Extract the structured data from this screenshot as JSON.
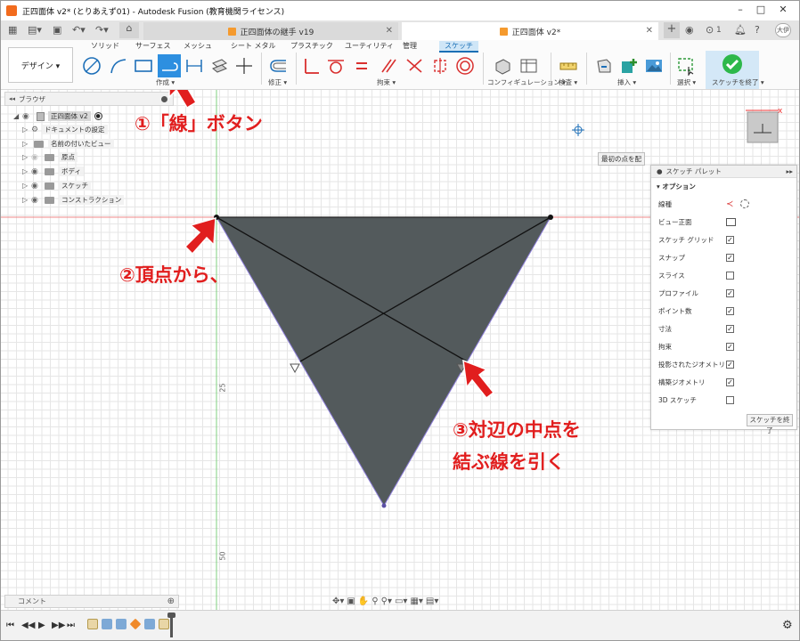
{
  "window": {
    "title": "正四面体 v2* (とりあえず01) - Autodesk Fusion (教育機関ライセンス)",
    "controls": [
      "–",
      "□",
      "✕"
    ]
  },
  "doc_tabs": [
    {
      "label": "正四面体の継手 v19",
      "active": false
    },
    {
      "label": "正四面体 v2*",
      "active": true
    }
  ],
  "tabbar_right": {
    "notifications": "1",
    "user_initial": "大伊"
  },
  "toolbar": {
    "design_label": "デザイン ▾",
    "tabs": [
      "ソリッド",
      "サーフェス",
      "メッシュ",
      "シート メタル",
      "プラスチック",
      "ユーティリティ",
      "管理",
      "スケッチ"
    ],
    "groups": [
      "作成 ▾",
      "修正 ▾",
      "拘束 ▾",
      "コンフィギュレーション ▾",
      "検査 ▾",
      "挿入 ▾",
      "選択 ▾",
      "スケッチを終了 ▾"
    ]
  },
  "browser": {
    "header": "ブラウザ",
    "root": "正四面体 v2",
    "items": [
      "ドキュメントの設定",
      "名前の付いたビュー",
      "原点",
      "ボディ",
      "スケッチ",
      "コンストラクション"
    ]
  },
  "canvas": {
    "tooltip": "最初の点を配",
    "axis_ticks": [
      "25",
      "50"
    ]
  },
  "palette": {
    "title": "スケッチ パレット",
    "section": "オプション",
    "rows": [
      {
        "label": "線種",
        "type": "icons"
      },
      {
        "label": "ビュー正面",
        "type": "icon"
      },
      {
        "label": "スケッチ グリッド",
        "checked": true
      },
      {
        "label": "スナップ",
        "checked": true
      },
      {
        "label": "スライス",
        "checked": false
      },
      {
        "label": "プロファイル",
        "checked": true
      },
      {
        "label": "ポイント数",
        "checked": true
      },
      {
        "label": "寸法",
        "checked": true
      },
      {
        "label": "拘束",
        "checked": true
      },
      {
        "label": "投影されたジオメトリ",
        "checked": true
      },
      {
        "label": "構築ジオメトリ",
        "checked": true
      },
      {
        "label": "3D スケッチ",
        "checked": false
      }
    ],
    "finish_button": "スケッチを終了"
  },
  "annotations": {
    "step1": "①「線」ボタン",
    "step2": "②頂点から、",
    "step3_line1": "③対辺の中点を",
    "step3_line2": "結ぶ線を引く"
  },
  "bottom": {
    "comment_label": "コメント"
  },
  "colors": {
    "accent": "#1a6fb5",
    "triangle_fill": "#535a5c",
    "annotation": "#e11e1e",
    "finish_green": "#2db84a"
  }
}
